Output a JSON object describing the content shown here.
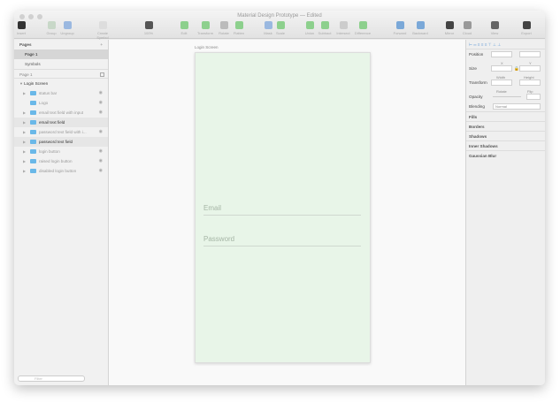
{
  "window": {
    "title": "Material Design Prototype — Edited"
  },
  "toolbar": [
    {
      "label": "Insert",
      "color": "#333"
    },
    {
      "label": "Group",
      "color": "#c8d8c8"
    },
    {
      "label": "Ungroup",
      "color": "#9ab8e0"
    },
    {
      "label": "Create Symbol",
      "color": "#ddd"
    },
    {
      "label": "100%",
      "color": "#555"
    },
    {
      "label": "Edit",
      "color": "#8dd08d"
    },
    {
      "label": "Transform",
      "color": "#8dd08d"
    },
    {
      "label": "Rotate",
      "color": "#bbb"
    },
    {
      "label": "Flatten",
      "color": "#8dd08d"
    },
    {
      "label": "Mask",
      "color": "#9ab8e0"
    },
    {
      "label": "Scale",
      "color": "#8dd08d"
    },
    {
      "label": "Union",
      "color": "#8dd08d"
    },
    {
      "label": "Subtract",
      "color": "#8dd08d"
    },
    {
      "label": "Intersect",
      "color": "#ccc"
    },
    {
      "label": "Difference",
      "color": "#8dd08d"
    },
    {
      "label": "Forward",
      "color": "#7aa8d8"
    },
    {
      "label": "Backward",
      "color": "#7aa8d8"
    },
    {
      "label": "Mirror",
      "color": "#444"
    },
    {
      "label": "Cloud",
      "color": "#999"
    },
    {
      "label": "View",
      "color": "#666"
    },
    {
      "label": "Export",
      "color": "#444"
    }
  ],
  "pages": {
    "header": "Pages",
    "items": [
      "Page 1",
      "Symbols"
    ],
    "current": "Page 1"
  },
  "layers": {
    "artboard": "Login Screen",
    "items": [
      {
        "name": "status bar",
        "bold": false
      },
      {
        "name": "Logo",
        "bold": false
      },
      {
        "name": "email text field with input",
        "bold": false
      },
      {
        "name": "email text field",
        "bold": true
      },
      {
        "name": "password text field with i...",
        "bold": false
      },
      {
        "name": "password text field",
        "bold": true
      },
      {
        "name": "login button",
        "bold": false
      },
      {
        "name": "raised login button",
        "bold": false
      },
      {
        "name": "disabled login button",
        "bold": false
      }
    ]
  },
  "canvas": {
    "artboard_label": "Login Screen",
    "email_placeholder": "Email",
    "password_placeholder": "Password"
  },
  "inspector": {
    "position": "Position",
    "x": "X",
    "y": "Y",
    "size": "Size",
    "width": "Width",
    "height": "Height",
    "transform": "Transform",
    "rotate": "Rotate",
    "flip": "Flip",
    "opacity": "Opacity",
    "blending": "Blending",
    "blend_value": "Normal",
    "sections": [
      "Fills",
      "Borders",
      "Shadows",
      "Inner Shadows",
      "Gaussian Blur"
    ]
  },
  "search": {
    "placeholder": "Filter"
  }
}
